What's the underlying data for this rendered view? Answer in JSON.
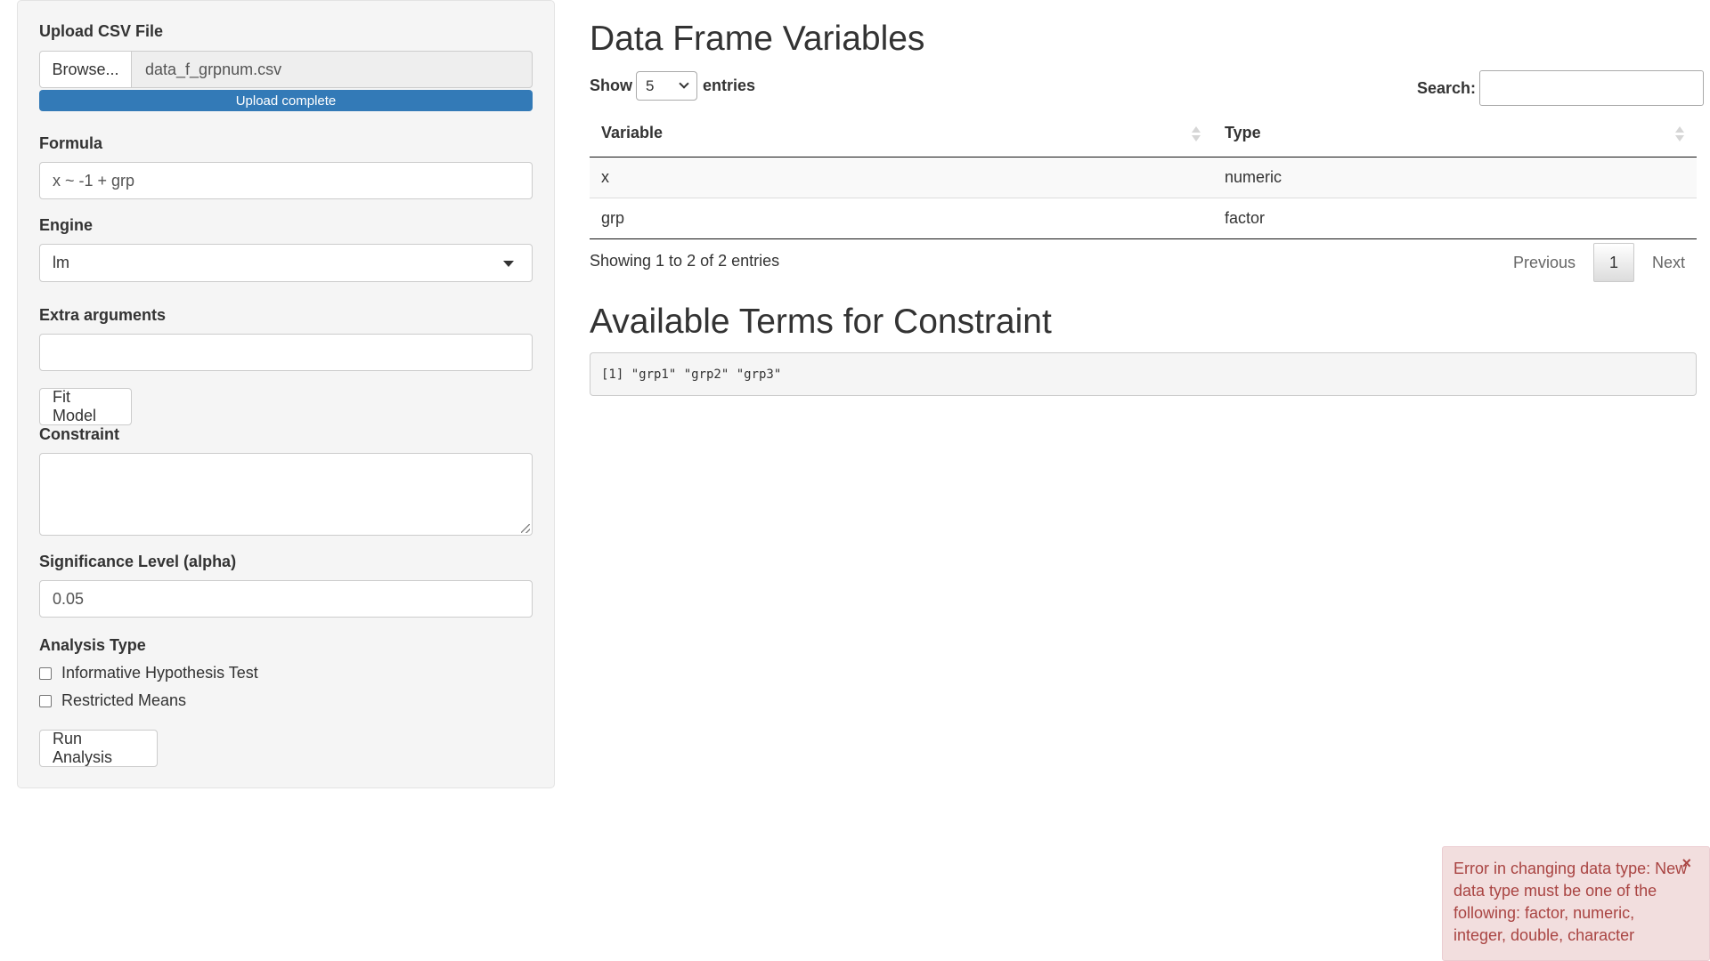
{
  "sidebar": {
    "upload": {
      "label": "Upload CSV File",
      "browse_label": "Browse...",
      "file_name": "data_f_grpnum.csv",
      "progress_label": "Upload complete",
      "progress_percent": 100
    },
    "formula": {
      "label": "Formula",
      "value": "x ~ -1 + grp"
    },
    "engine": {
      "label": "Engine",
      "selected": "lm"
    },
    "extra_args": {
      "label": "Extra arguments",
      "value": ""
    },
    "fit_button": "Fit Model",
    "constraint": {
      "label": "Constraint",
      "value": ""
    },
    "alpha": {
      "label": "Significance Level (alpha)",
      "value": "0.05"
    },
    "analysis_type": {
      "label": "Analysis Type",
      "options": [
        {
          "label": "Informative Hypothesis Test",
          "checked": false
        },
        {
          "label": "Restricted Means",
          "checked": false
        }
      ]
    },
    "run_button": "Run Analysis"
  },
  "main": {
    "variables_title": "Data Frame Variables",
    "length": {
      "show": "Show",
      "value": "5",
      "entries": "entries"
    },
    "search_label": "Search:",
    "search_value": "",
    "table": {
      "headers": [
        "Variable",
        "Type"
      ],
      "rows": [
        [
          "x",
          "numeric"
        ],
        [
          "grp",
          "factor"
        ]
      ]
    },
    "info": "Showing 1 to 2 of 2 entries",
    "pager": {
      "previous": "Previous",
      "current": "1",
      "next": "Next"
    },
    "terms_title": "Available Terms for Constraint",
    "terms_output": "[1] \"grp1\" \"grp2\" \"grp3\""
  },
  "notification": {
    "message": "Error in changing data type: New data type must be one of the following: factor, numeric, integer, double, character",
    "close_symbol": "×",
    "color": "#a94442"
  },
  "colors": {
    "accent": "#337ab7",
    "sidebar_bg": "#f5f5f5",
    "error_bg": "#f2dede"
  }
}
